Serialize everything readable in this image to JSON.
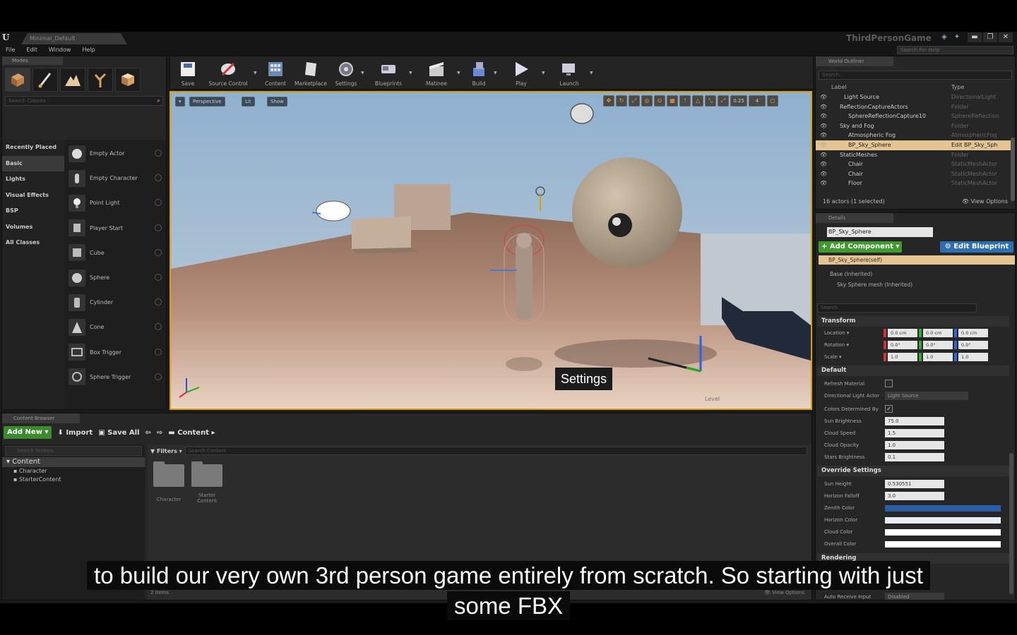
{
  "window": {
    "logo": "U",
    "level_tab": "Minimal_Default",
    "project_name": "ThirdPersonGame",
    "help_search_placeholder": "Search For Help",
    "controls": [
      "▬",
      "❐",
      "✕"
    ]
  },
  "menu": [
    "File",
    "Edit",
    "Window",
    "Help"
  ],
  "modes": {
    "tab": "Modes",
    "search_placeholder": "Search Classes",
    "categories": [
      "Recently Placed",
      "Basic",
      "Lights",
      "Visual Effects",
      "BSP",
      "Volumes",
      "All Classes"
    ],
    "active_category": "Basic",
    "items": [
      "Empty Actor",
      "Empty Character",
      "Point Light",
      "Player Start",
      "Cube",
      "Sphere",
      "Cylinder",
      "Cone",
      "Box Trigger",
      "Sphere Trigger"
    ]
  },
  "toolbar": {
    "buttons": [
      {
        "label": "Save",
        "icon": "save-icon"
      },
      {
        "label": "Source Control",
        "icon": "source-control-icon"
      },
      {
        "label": "Content",
        "icon": "content-icon"
      },
      {
        "label": "Marketplace",
        "icon": "marketplace-icon"
      },
      {
        "label": "Settings",
        "icon": "settings-icon"
      },
      {
        "label": "Blueprints",
        "icon": "blueprints-icon"
      },
      {
        "label": "Matinee",
        "icon": "matinee-icon"
      },
      {
        "label": "Build",
        "icon": "build-icon"
      },
      {
        "label": "Play",
        "icon": "play-icon"
      },
      {
        "label": "Launch",
        "icon": "launch-icon"
      }
    ]
  },
  "viewport": {
    "perspective": "Perspective",
    "lit": "Lit",
    "show": "Show",
    "snap_value": "0.25",
    "camera_speed": "4",
    "level_label": "Level",
    "settings_tooltip": "Settings"
  },
  "content_browser": {
    "tab": "Content Browser",
    "add_new": "Add New",
    "import": "Import",
    "save_all": "Save All",
    "path": "Content",
    "search_folders_placeholder": "Search Folders",
    "filters": "Filters",
    "search_content_placeholder": "Search Content",
    "tree": [
      "Content",
      "Character",
      "StarterContent"
    ],
    "folders": [
      "Character",
      "Starter Content"
    ],
    "item_count": "2 items",
    "view_options": "View Options"
  },
  "outliner": {
    "tab": "World Outliner",
    "search_placeholder": "Search...",
    "col_label": "Label",
    "col_type": "Type",
    "rows": [
      {
        "name": "Light Source",
        "type": "DirectionalLight",
        "indent": 3
      },
      {
        "name": "ReflectionCaptureActors",
        "type": "Folder",
        "indent": 2
      },
      {
        "name": "SphereReflectionCapture10",
        "type": "SphereReflection",
        "indent": 4
      },
      {
        "name": "Sky and Fog",
        "type": "Folder",
        "indent": 2
      },
      {
        "name": "Atmospheric Fog",
        "type": "AtmosphericFog",
        "indent": 4
      },
      {
        "name": "BP_Sky_Sphere",
        "type": "Edit BP_Sky_Sph",
        "indent": 4,
        "selected": true
      },
      {
        "name": "StaticMeshes",
        "type": "Folder",
        "indent": 2
      },
      {
        "name": "Chair",
        "type": "StaticMeshActor",
        "indent": 4
      },
      {
        "name": "Chair",
        "type": "StaticMeshActor",
        "indent": 4
      },
      {
        "name": "Floor",
        "type": "StaticMeshActor",
        "indent": 4
      }
    ],
    "footer": "16 actors (1 selected)",
    "view_options": "View Options"
  },
  "details": {
    "tab": "Details",
    "actor_name": "BP_Sky_Sphere",
    "add_component": "+ Add Component",
    "edit_blueprint": "Edit Blueprint",
    "self_label": "BP_Sky_Sphere(self)",
    "components": [
      "Base (Inherited)",
      "Sky Sphere mesh (Inherited)"
    ],
    "search_placeholder": "Search",
    "sections": {
      "transform": "Transform",
      "default": "Default",
      "override": "Override Settings",
      "rendering": "Rendering"
    },
    "transform": {
      "location_label": "Location ▾",
      "rotation_label": "Rotation ▾",
      "scale_label": "Scale ▾",
      "location": [
        "0.0 cm",
        "0.0 cm",
        "0.0 cm"
      ],
      "rotation": [
        "0.0°",
        "0.0°",
        "0.0°"
      ],
      "scale": [
        "1.0",
        "1.0",
        "1.0"
      ]
    },
    "default_props": {
      "refresh_material": "Refresh Material",
      "directional_light_actor": "Directional Light Actor",
      "directional_light_value": "Light Source",
      "colors_determined_by": "Colors Determined By",
      "sun_brightness": "Sun Brightness",
      "sun_brightness_value": "75.0",
      "cloud_speed": "Cloud Speed",
      "cloud_speed_value": "1.5",
      "cloud_opacity": "Cloud Opacity",
      "cloud_opacity_value": "1.0",
      "stars_brightness": "Stars Brightness",
      "stars_brightness_value": "0.1"
    },
    "override_props": {
      "sun_height": "Sun Height",
      "sun_height_value": "0.530551",
      "horizon_falloff": "Horizon Falloff",
      "horizon_falloff_value": "3.0",
      "zenith_color": "Zenith Color",
      "horizon_color": "Horizon Color",
      "cloud_color": "Cloud Color",
      "overall_color": "Overall Color"
    },
    "colors": {
      "zenith": "#2a5fa8",
      "horizon": "#e8eef6",
      "cloud": "#ffffff",
      "overall": "#ffffff"
    },
    "auto_receive_input": "Auto Receive Input",
    "auto_receive_value": "Disabled"
  },
  "subtitle": {
    "line1": "to build our very own 3rd person game entirely from scratch. So starting with just",
    "line2": "some FBX"
  },
  "accent_colors": {
    "viewport_border": "#d8a100",
    "green_button": "#3c8a2c",
    "blue_button": "#2f6fb0",
    "selection": "#e4c490"
  }
}
